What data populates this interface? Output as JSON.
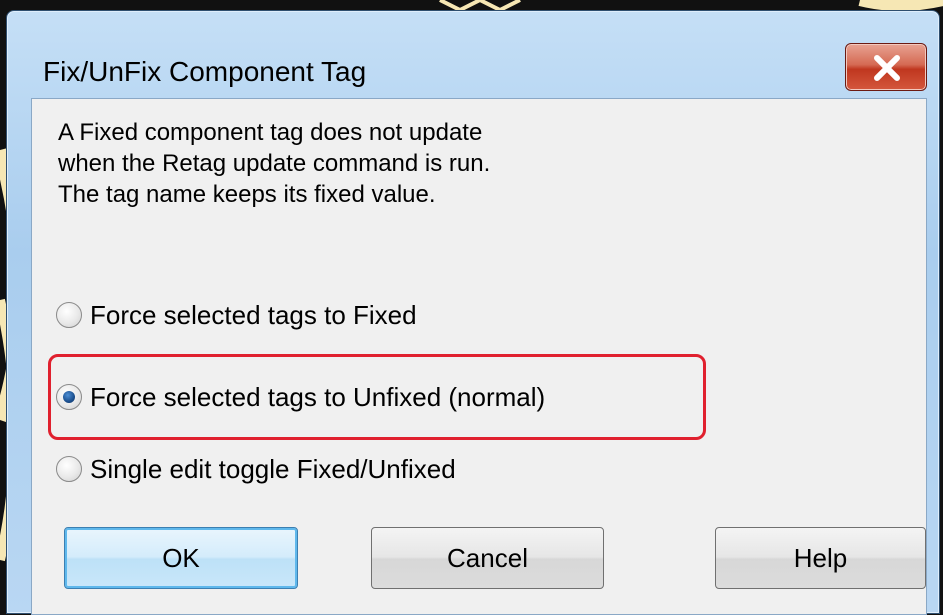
{
  "dialog": {
    "title": "Fix/UnFix Component Tag",
    "close_label": "X",
    "description": [
      "A Fixed component tag does not update",
      "when the Retag update command is run.",
      "The tag name keeps its fixed value."
    ],
    "options": [
      {
        "label": "Force selected tags to Fixed",
        "checked": false
      },
      {
        "label": "Force selected tags to Unfixed (normal)",
        "checked": true
      },
      {
        "label": "Single edit toggle Fixed/Unfixed",
        "checked": false
      }
    ],
    "buttons": {
      "ok": "OK",
      "cancel": "Cancel",
      "help": "Help"
    },
    "highlight_color": "#e0202e"
  }
}
